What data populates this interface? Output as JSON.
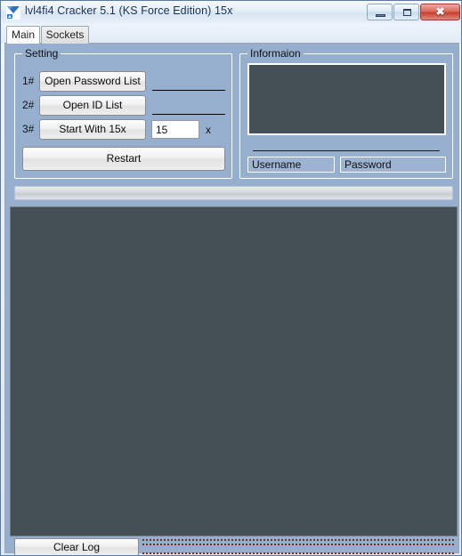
{
  "window": {
    "title": "lvl4fi4 Cracker 5.1 (KS Force Edition) 15x",
    "icon": "app-icon",
    "controls": {
      "minimize": "minimize-icon",
      "maximize": "maximize-icon",
      "close": "✖"
    }
  },
  "tabs": [
    {
      "label": "Main",
      "active": true
    },
    {
      "label": "Sockets",
      "active": false
    }
  ],
  "setting": {
    "group_title": "Setting",
    "rows": [
      {
        "step": "1#",
        "button": "Open Password List",
        "value": ""
      },
      {
        "step": "2#",
        "button": "Open ID List",
        "value": ""
      },
      {
        "step": "3#",
        "button": "Start With 15x",
        "value": "15",
        "suffix": "x"
      }
    ],
    "restart_button": "Restart"
  },
  "information": {
    "group_title": "Informaion",
    "log_text": "",
    "status_line": "",
    "username_field": "Username",
    "password_field": "Password"
  },
  "progress": {
    "value": "",
    "percent": 0
  },
  "log": {
    "content": ""
  },
  "footer": {
    "clear_log_button": "Clear Log",
    "status_text": ""
  },
  "colors": {
    "window_background": "#97afce",
    "dark_panel": "#454f56",
    "title_text": "#16325c",
    "close_button": "#c44033",
    "dotted_status": "#8a2b10"
  }
}
